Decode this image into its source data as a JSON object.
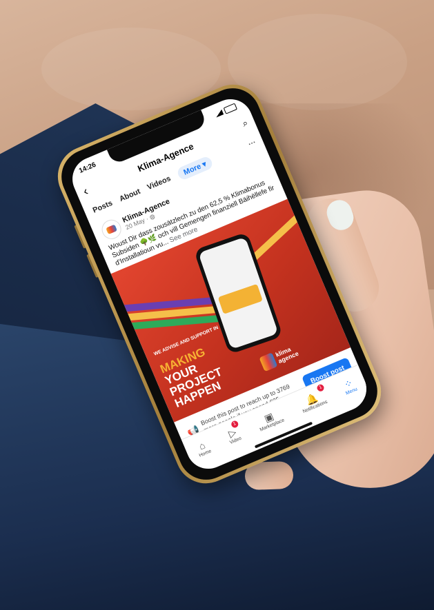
{
  "status": {
    "time": "14:26"
  },
  "header": {
    "title": "Klima-Agence",
    "back_icon": "chevron-left-icon",
    "search_icon": "search-icon"
  },
  "tabs": [
    {
      "label": "Posts"
    },
    {
      "label": "About"
    },
    {
      "label": "Videos"
    },
    {
      "label": "More ▾"
    }
  ],
  "tabs_more_icon": "ellipsis-icon",
  "post": {
    "page_name": "Klima-Agence",
    "date": "20 May · ◍",
    "text": "Woust Dir dass zousätzlech zu den 62,5 % Klimabonus Subsiden 🌳🌿 och vill Gemengen finanziell Bäihëllefe fir d'Installatioun vu...",
    "see_more": "See more",
    "image": {
      "subheadline": "WE ADVISE AND SUPPORT IN",
      "headline_line1": "MAKING",
      "headline_line2": "YOUR",
      "headline_line3": "PROJECT",
      "headline_line4": "HAPPEN",
      "logo_text_line1": "klima",
      "logo_text_line2": "agence"
    }
  },
  "boost": {
    "text": "Boost this post to reach up to 3769 more people if you spend €25.",
    "button": "Boost post"
  },
  "bottom_nav": [
    {
      "label": "Home",
      "icon": "home-icon",
      "badge": "",
      "active": false
    },
    {
      "label": "Video",
      "icon": "video-icon",
      "badge": "1",
      "active": false
    },
    {
      "label": "Marketplace",
      "icon": "marketplace-icon",
      "badge": "",
      "active": false
    },
    {
      "label": "Notifications",
      "icon": "bell-icon",
      "badge": "1",
      "active": false
    },
    {
      "label": "Menu",
      "icon": "menu-grid-icon",
      "badge": "",
      "active": true
    }
  ],
  "colors": {
    "accent": "#1877f2",
    "badge": "#e41e3f",
    "poster_red": "#d63a26",
    "poster_yellow": "#f7b233"
  }
}
